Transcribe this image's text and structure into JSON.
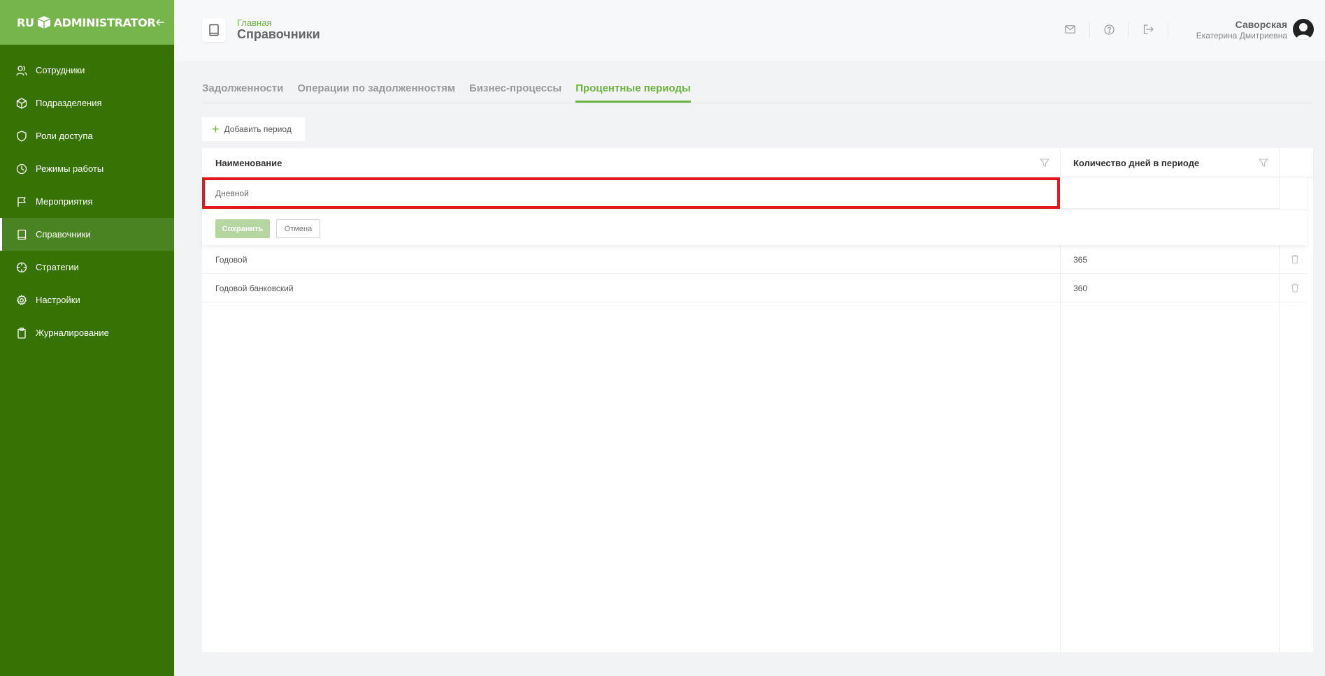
{
  "sidebar": {
    "logo_left": "RU",
    "logo_right": "ADMINISTRATOR",
    "items": [
      {
        "label": "Сотрудники",
        "icon": "users-icon"
      },
      {
        "label": "Подразделения",
        "icon": "cube-icon"
      },
      {
        "label": "Роли доступа",
        "icon": "shield-icon"
      },
      {
        "label": "Режимы работы",
        "icon": "clock-icon"
      },
      {
        "label": "Мероприятия",
        "icon": "flag-icon"
      },
      {
        "label": "Справочники",
        "icon": "book-icon",
        "active": true
      },
      {
        "label": "Стратегии",
        "icon": "crosshair-icon"
      },
      {
        "label": "Настройки",
        "icon": "gear-icon"
      },
      {
        "label": "Журналирование",
        "icon": "clipboard-icon"
      }
    ]
  },
  "header": {
    "breadcrumb": "Главная",
    "title": "Справочники",
    "user_last_name": "Саворская",
    "user_first_name": "Екатерина Дмитриевна"
  },
  "tabs": [
    {
      "label": "Задолженности"
    },
    {
      "label": "Операции по задолженностям"
    },
    {
      "label": "Бизнес-процессы"
    },
    {
      "label": "Процентные периоды",
      "active": true
    }
  ],
  "toolbar": {
    "add_label": "Добавить период"
  },
  "table": {
    "columns": [
      "Наименование",
      "Количество дней в периоде"
    ],
    "editing": {
      "name_value": "Дневной",
      "save_label": "Сохранить",
      "cancel_label": "Отмена"
    },
    "rows": [
      {
        "name": "Годовой",
        "days": "365"
      },
      {
        "name": "Годовой банковский",
        "days": "360"
      }
    ]
  },
  "colors": {
    "sidebar_bg": "#367304",
    "sidebar_header_bg": "#76b54b",
    "accent": "#6db33f",
    "highlight": "#e3161d"
  }
}
